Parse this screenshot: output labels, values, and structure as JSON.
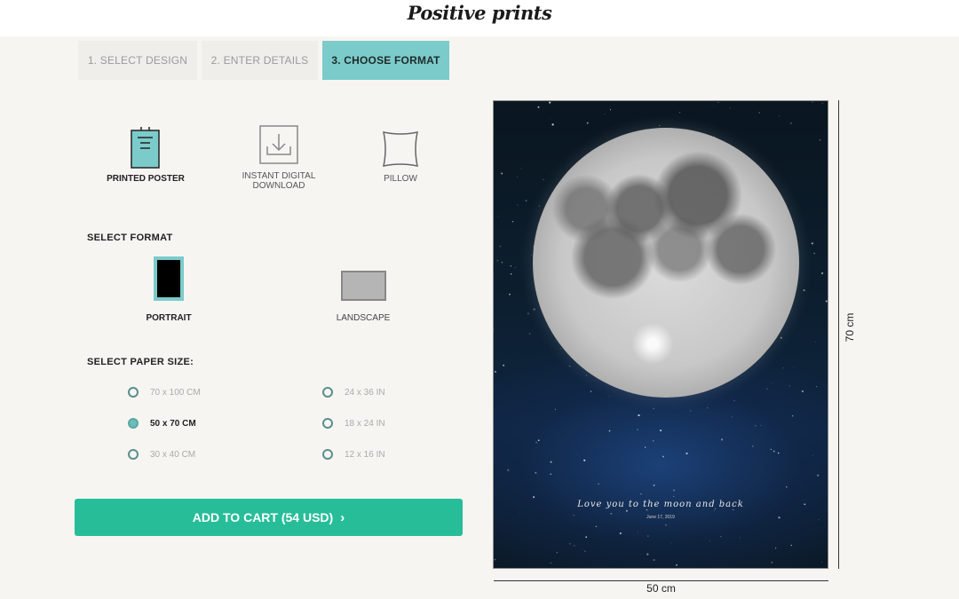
{
  "header": {
    "logo": "Positive prints"
  },
  "steps": [
    {
      "label": "1. SELECT DESIGN",
      "active": false
    },
    {
      "label": "2. ENTER DETAILS",
      "active": false
    },
    {
      "label": "3. CHOOSE FORMAT",
      "active": true
    }
  ],
  "products": [
    {
      "label": "PRINTED POSTER",
      "icon": "poster-icon",
      "selected": true
    },
    {
      "label": "INSTANT DIGITAL DOWNLOAD",
      "icon": "download-icon",
      "selected": false
    },
    {
      "label": "PILLOW",
      "icon": "pillow-icon",
      "selected": false
    }
  ],
  "format": {
    "title": "SELECT FORMAT",
    "options": [
      {
        "label": "PORTRAIT",
        "selected": true
      },
      {
        "label": "LANDSCAPE",
        "selected": false
      }
    ]
  },
  "paper_size": {
    "title": "SELECT PAPER SIZE:",
    "options": [
      {
        "label": "70 x 100 CM",
        "selected": false
      },
      {
        "label": "50 x 70 CM",
        "selected": true
      },
      {
        "label": "30 x 40 CM",
        "selected": false
      },
      {
        "label": "24 x 36 IN",
        "selected": false
      },
      {
        "label": "18 x 24 IN",
        "selected": false
      },
      {
        "label": "12 x 16 IN",
        "selected": false
      }
    ]
  },
  "cart": {
    "label": "ADD TO CART (54 USD)",
    "chevron": "›"
  },
  "preview": {
    "tagline": "Love you to the moon and back",
    "date": "June 17, 2019",
    "width_label": "50 cm",
    "height_label": "70 cm"
  },
  "colors": {
    "accent_teal": "#7ccbcb",
    "cart_green": "#27bd99",
    "background": "#f6f5f1"
  }
}
